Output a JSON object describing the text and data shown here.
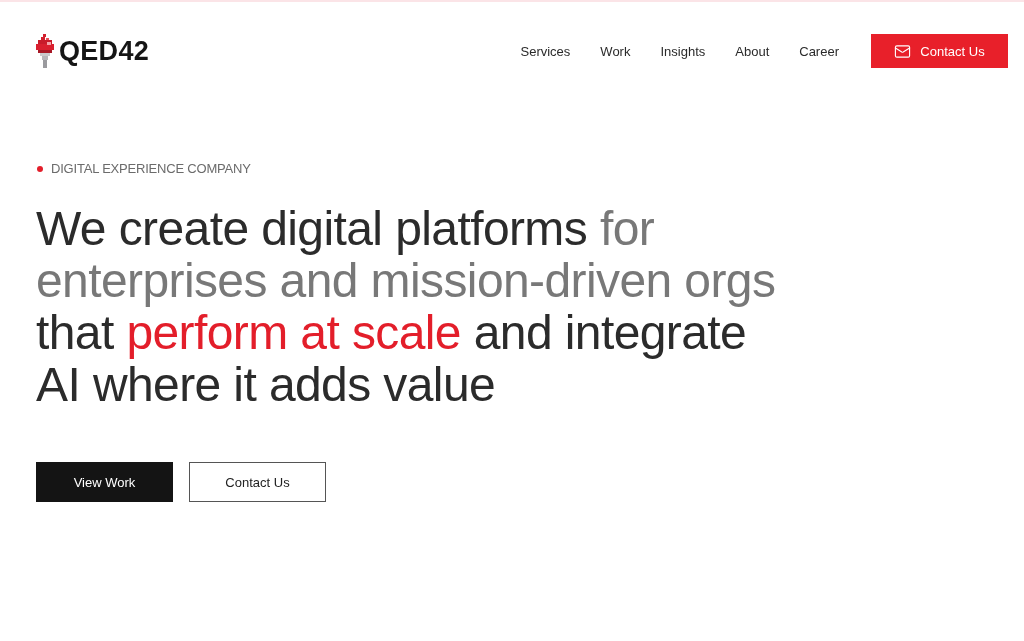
{
  "header": {
    "logo": {
      "text": "QED42"
    },
    "nav": [
      "Services",
      "Work",
      "Insights",
      "About",
      "Career"
    ],
    "cta": {
      "label": "Contact Us"
    }
  },
  "hero": {
    "eyebrow": "DIGITAL EXPERIENCE COMPANY",
    "headline": {
      "lines": [
        {
          "segments": [
            {
              "text": "We create digital platforms",
              "color": "#2b2b2b"
            },
            {
              "text": "for",
              "color": "#787878"
            }
          ]
        },
        {
          "segments": [
            {
              "text": "enterprises and mission-driven orgs",
              "color": "#787878"
            }
          ]
        },
        {
          "segments": [
            {
              "text": "that",
              "color": "#2b2b2b"
            },
            {
              "text": "perform at scale",
              "color": "#e31e2a"
            },
            {
              "text": "and integrate",
              "color": "#2b2b2b"
            }
          ]
        },
        {
          "segments": [
            {
              "text": "AI where it adds value",
              "color": "#2b2b2b"
            }
          ]
        }
      ]
    },
    "buttons": [
      {
        "label": "View Work",
        "kind": "primary"
      },
      {
        "label": "Contact Us",
        "kind": "secondary"
      }
    ]
  }
}
